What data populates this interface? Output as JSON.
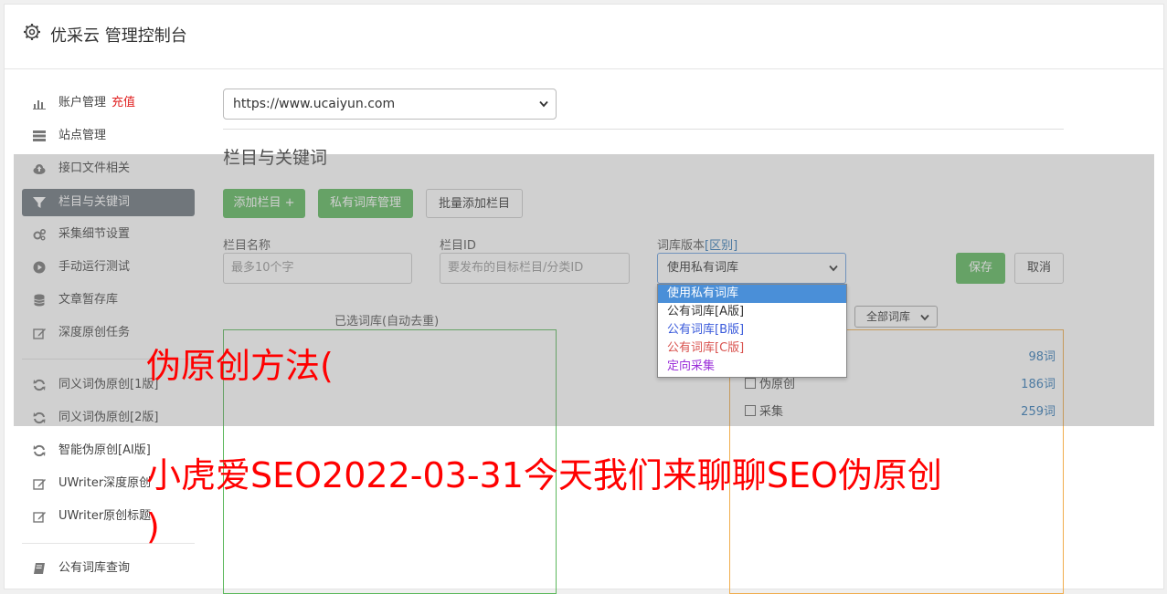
{
  "header": {
    "title": "优采云 管理控制台",
    "icon": "gear-icon"
  },
  "sidebar": {
    "items": [
      {
        "label": "账户管理",
        "badge": "充值",
        "icon": "bar-chart-icon"
      },
      {
        "label": "站点管理",
        "icon": "server-icon"
      },
      {
        "label": "接口文件相关",
        "icon": "cloud-upload-icon"
      },
      {
        "label": "栏目与关键词",
        "icon": "filter-icon",
        "active": true
      },
      {
        "label": "采集细节设置",
        "icon": "gears-icon"
      },
      {
        "label": "手动运行测试",
        "icon": "play-circle-icon"
      },
      {
        "label": "文章暂存库",
        "icon": "database-icon"
      },
      {
        "label": "深度原创任务",
        "icon": "edit-icon"
      },
      {
        "label": "同义词伪原创[1版]",
        "icon": "refresh-icon"
      },
      {
        "label": "同义词伪原创[2版]",
        "icon": "refresh-icon"
      },
      {
        "label": "智能伪原创[AI版]",
        "icon": "refresh-icon"
      },
      {
        "label": "UWriter深度原创",
        "icon": "edit-icon"
      },
      {
        "label": "UWriter原创标题",
        "icon": "edit-icon"
      },
      {
        "label": "公有词库查询",
        "icon": "book-icon"
      }
    ]
  },
  "site_select": {
    "value": "https://www.ucaiyun.com"
  },
  "section": {
    "title": "栏目与关键词"
  },
  "toolbar": {
    "add_column": "添加栏目 +",
    "private_lib": "私有词库管理",
    "batch_add": "批量添加栏目"
  },
  "form": {
    "column_name_label": "栏目名称",
    "column_name_placeholder": "最多10个字",
    "column_id_label": "栏目ID",
    "column_id_placeholder": "要发布的目标栏目/分类ID",
    "lib_version_label": "词库版本",
    "lib_version_link": "[区别]",
    "lib_version_value": "使用私有词库",
    "save": "保存",
    "cancel": "取消"
  },
  "dropdown": {
    "options": [
      {
        "label": "使用私有词库",
        "color": "#ffffff",
        "selected": true
      },
      {
        "label": "公有词库[A版]",
        "color": "#333333"
      },
      {
        "label": "公有词库[B版]",
        "color": "#3b5bdb"
      },
      {
        "label": "公有词库[C版]",
        "color": "#d9534f"
      },
      {
        "label": "定向采集",
        "color": "#9b30d9"
      }
    ]
  },
  "panels": {
    "selected_title": "已选词库(自动去重)",
    "filter_value": "全部词库",
    "libraries": [
      {
        "name": "",
        "count": "98词"
      },
      {
        "name": "伪原创",
        "count": "186词"
      },
      {
        "name": "采集",
        "count": "259词"
      }
    ]
  },
  "watermark": {
    "line1": "伪原创方法(",
    "line2": "小虎爱SEO2022-03-31今天我们来聊聊SEO伪原创",
    "line3": ")"
  }
}
